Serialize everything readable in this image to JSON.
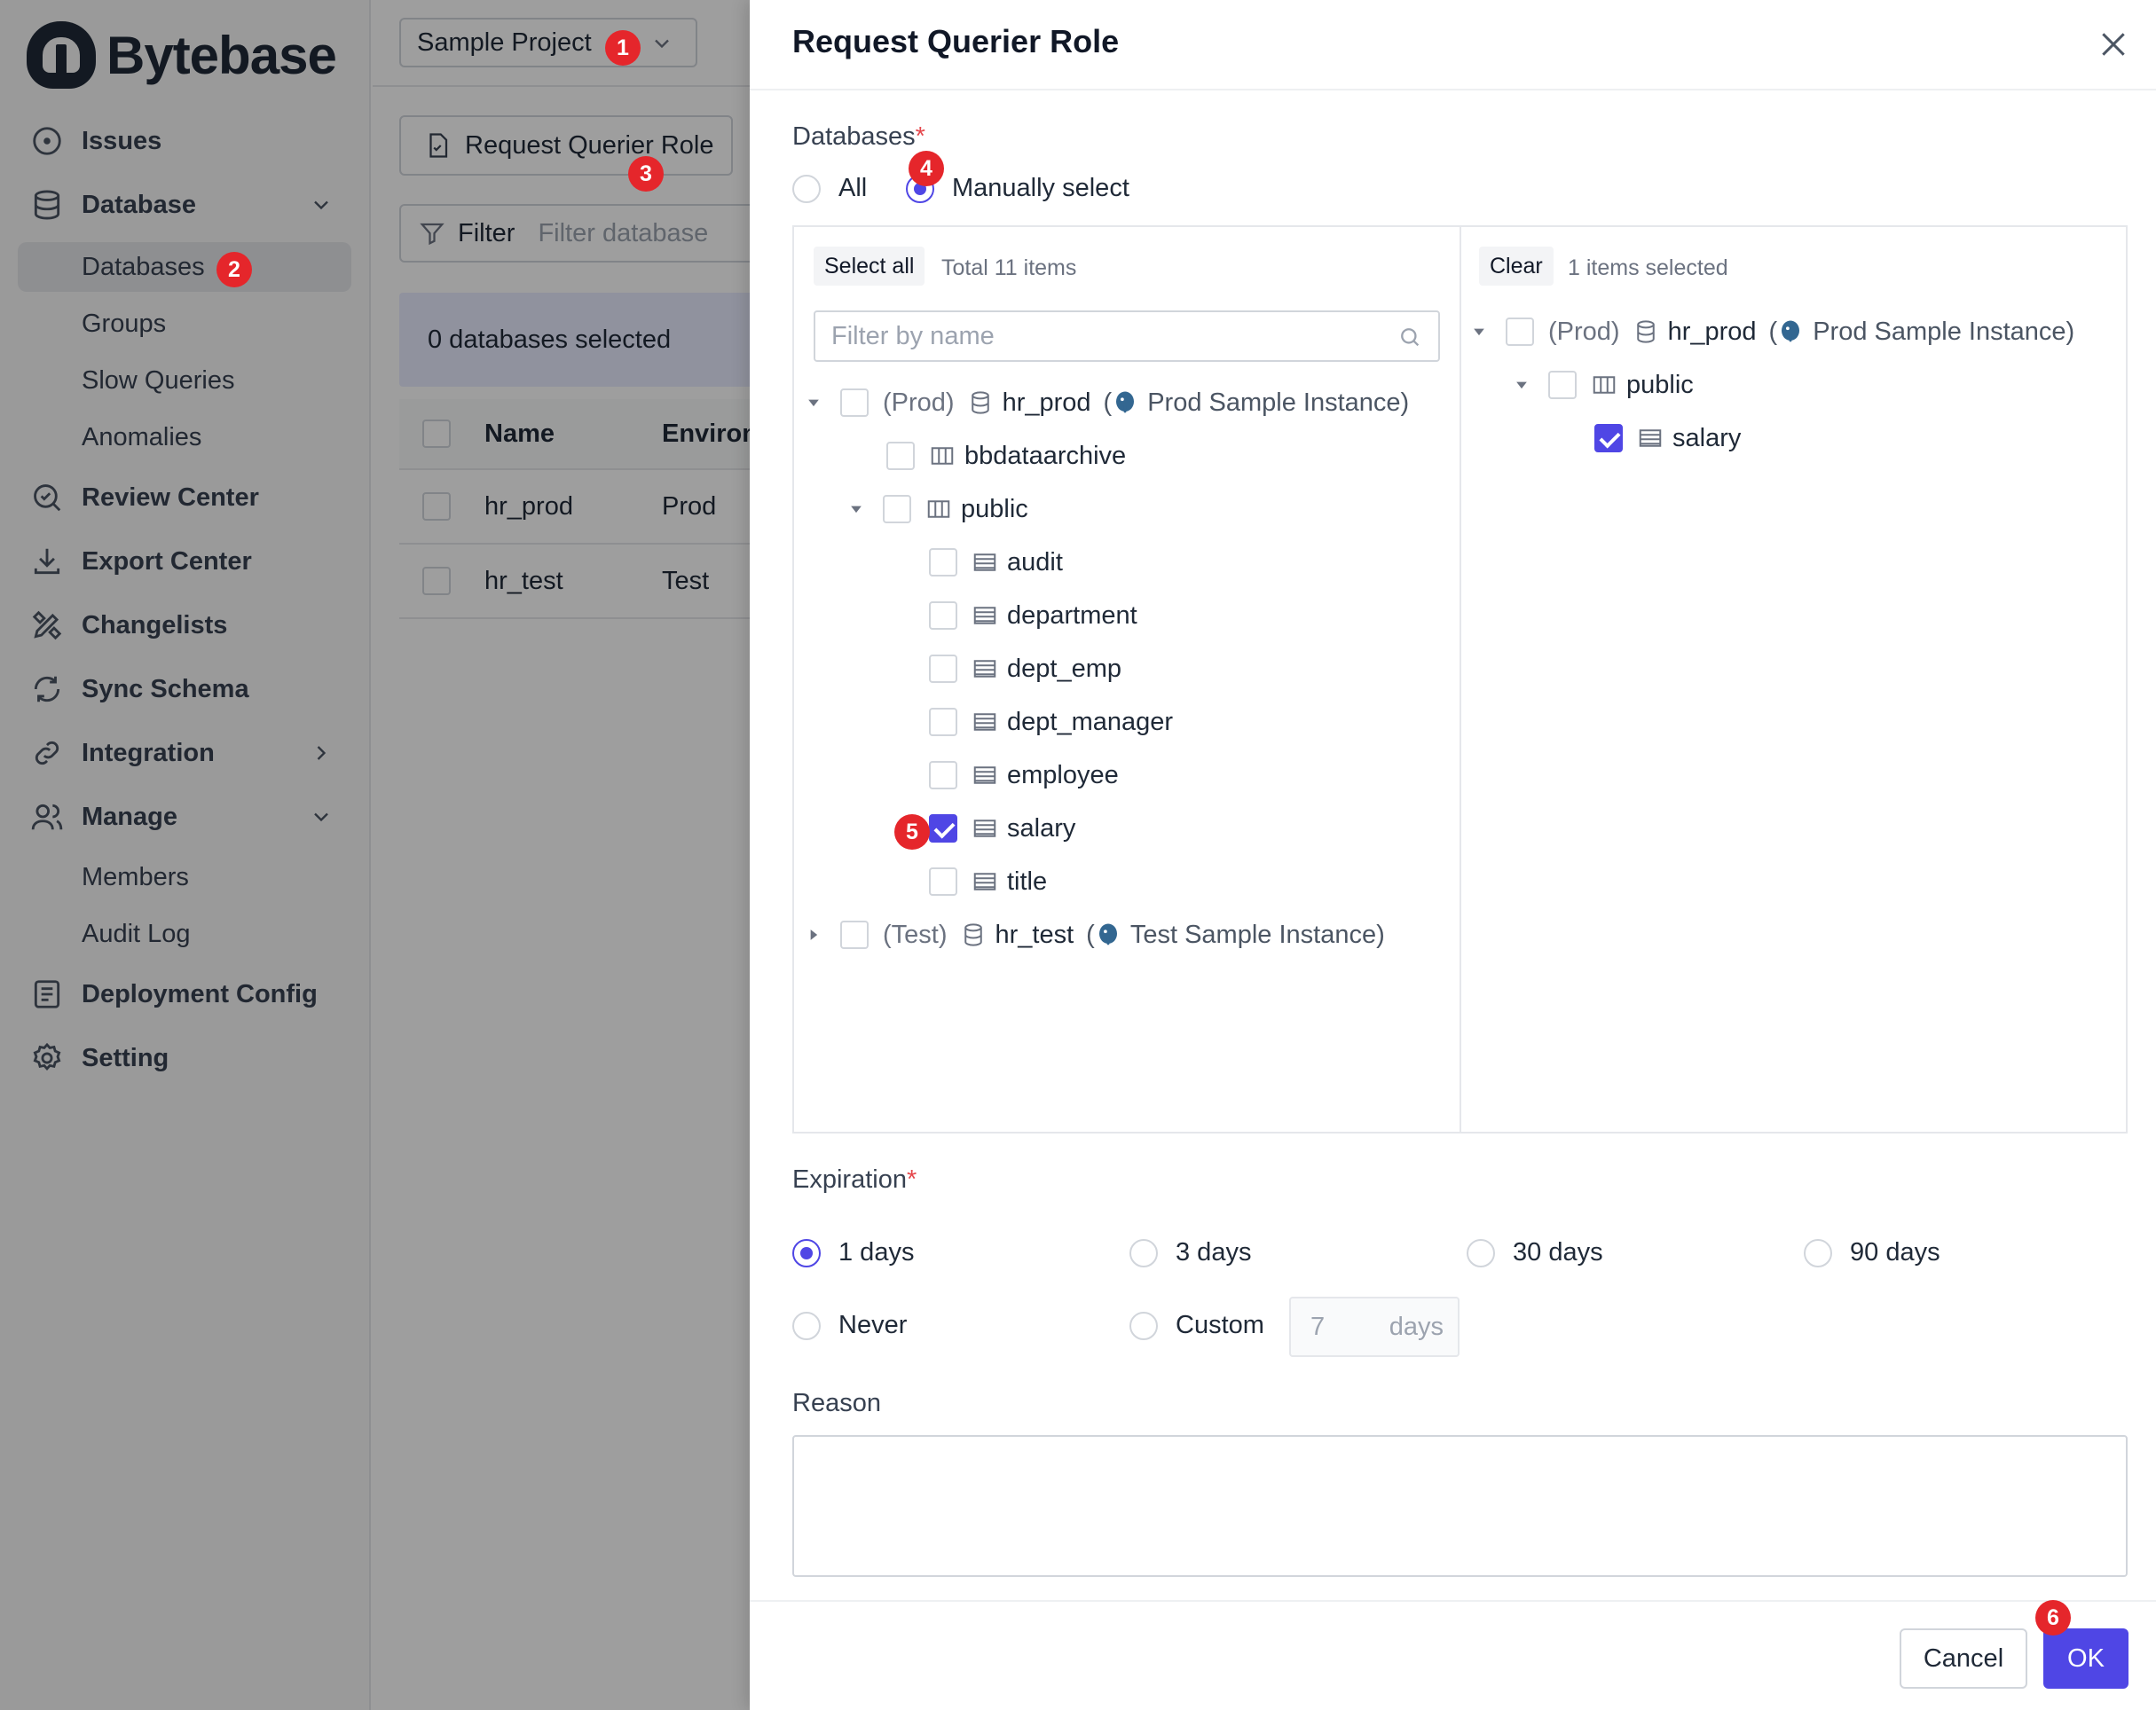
{
  "app": {
    "brand": "Bytebase"
  },
  "sidebar": {
    "items": [
      {
        "label": "Issues",
        "icon": "issues-icon"
      },
      {
        "label": "Database",
        "icon": "database-icon",
        "expandable": true
      },
      {
        "label": "Databases"
      },
      {
        "label": "Groups"
      },
      {
        "label": "Slow Queries"
      },
      {
        "label": "Anomalies"
      },
      {
        "label": "Review Center",
        "icon": "review-icon"
      },
      {
        "label": "Export Center",
        "icon": "download-icon"
      },
      {
        "label": "Changelists",
        "icon": "changelist-icon"
      },
      {
        "label": "Sync Schema",
        "icon": "sync-icon"
      },
      {
        "label": "Integration",
        "icon": "link-icon"
      },
      {
        "label": "Manage",
        "icon": "users-icon",
        "expandable": true
      },
      {
        "label": "Members"
      },
      {
        "label": "Audit Log"
      },
      {
        "label": "Deployment Config",
        "icon": "config-icon"
      },
      {
        "label": "Setting",
        "icon": "gear-icon"
      }
    ]
  },
  "main": {
    "project": "Sample Project",
    "request_button": "Request Querier Role",
    "filter_label": "Filter",
    "filter_placeholder": "Filter database",
    "selected_text": "0 databases selected",
    "table": {
      "headers": [
        "Name",
        "Environ"
      ],
      "rows": [
        {
          "name": "hr_prod",
          "env": "Prod"
        },
        {
          "name": "hr_test",
          "env": "Test"
        }
      ]
    }
  },
  "drawer": {
    "title": "Request Querier Role",
    "databases_label": "Databases",
    "required_mark": "*",
    "scope_options": [
      {
        "label": "All",
        "selected": false
      },
      {
        "label": "Manually select",
        "selected": true
      }
    ],
    "source": {
      "select_all": "Select all",
      "total": "Total 11 items",
      "search_placeholder": "Filter by name",
      "db1": {
        "env": "(Prod)",
        "name": "hr_prod",
        "instance": "Prod Sample Instance"
      },
      "schemas": [
        "bbdataarchive",
        "public"
      ],
      "tables": [
        "audit",
        "department",
        "dept_emp",
        "dept_manager",
        "employee",
        "salary",
        "title"
      ],
      "db2": {
        "env": "(Test)",
        "name": "hr_test",
        "instance": "Test Sample Instance"
      }
    },
    "target": {
      "clear": "Clear",
      "count": "1 items selected",
      "db": {
        "env": "(Prod)",
        "name": "hr_prod",
        "instance": "Prod Sample Instance"
      },
      "schema": "public",
      "table": "salary"
    },
    "expiration_label": "Expiration",
    "expiration_options": [
      "1 days",
      "3 days",
      "30 days",
      "90 days",
      "Never",
      "Custom"
    ],
    "expiration_selected": "1 days",
    "custom_days_placeholder": "7",
    "custom_days_unit": "days",
    "reason_label": "Reason",
    "reason_value": "",
    "cancel": "Cancel",
    "ok": "OK"
  },
  "steps": [
    "1",
    "2",
    "3",
    "4",
    "5",
    "6"
  ],
  "colors": {
    "accent": "#4f46e5",
    "badge": "#e5262b",
    "required": "#e5484d"
  }
}
